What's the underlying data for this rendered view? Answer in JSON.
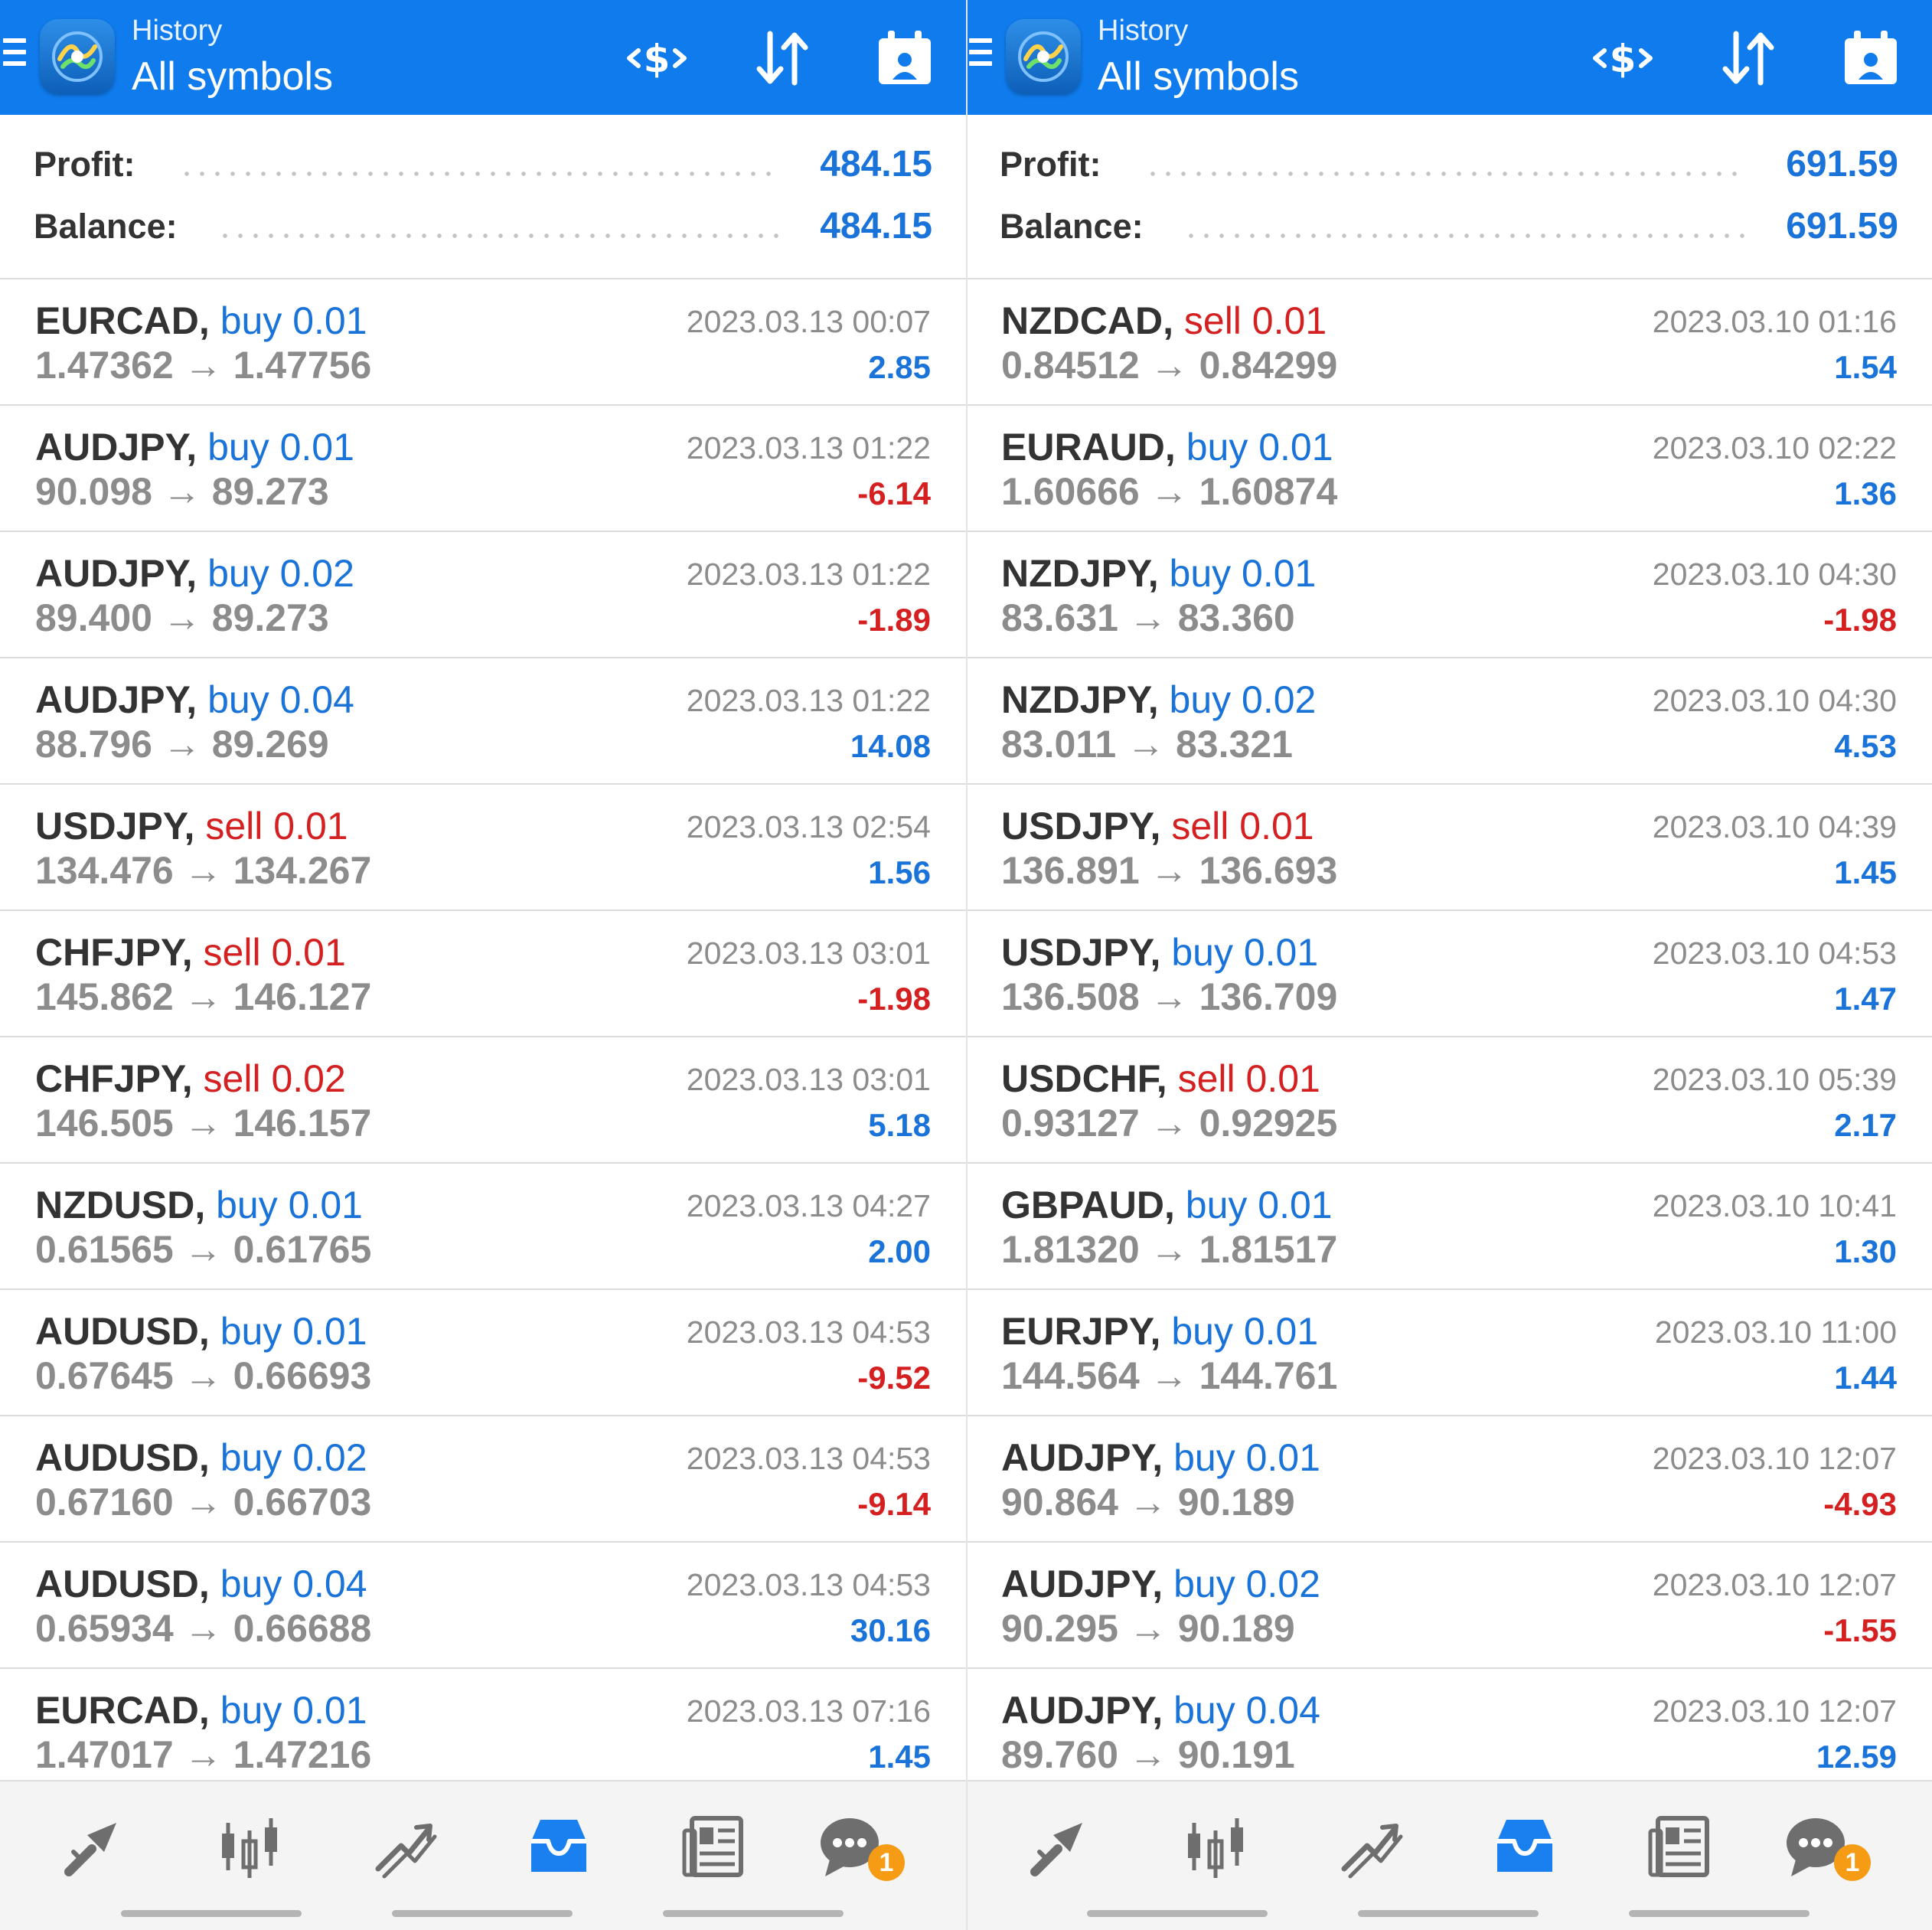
{
  "left": {
    "header": {
      "title": "History",
      "subtitle": "All symbols"
    },
    "summary": {
      "profit_label": "Profit:",
      "profit_value": "484.15",
      "balance_label": "Balance:",
      "balance_value": "484.15"
    },
    "deals": [
      {
        "symbol": "EURCAD,",
        "type": "buy 0.01",
        "side": "buy",
        "open": "1.47362",
        "close": "1.47756",
        "time": "2023.03.13 00:07",
        "profit": "2.85"
      },
      {
        "symbol": "AUDJPY,",
        "type": "buy 0.01",
        "side": "buy",
        "open": "90.098",
        "close": "89.273",
        "time": "2023.03.13 01:22",
        "profit": "-6.14"
      },
      {
        "symbol": "AUDJPY,",
        "type": "buy 0.02",
        "side": "buy",
        "open": "89.400",
        "close": "89.273",
        "time": "2023.03.13 01:22",
        "profit": "-1.89"
      },
      {
        "symbol": "AUDJPY,",
        "type": "buy 0.04",
        "side": "buy",
        "open": "88.796",
        "close": "89.269",
        "time": "2023.03.13 01:22",
        "profit": "14.08"
      },
      {
        "symbol": "USDJPY,",
        "type": "sell 0.01",
        "side": "sell",
        "open": "134.476",
        "close": "134.267",
        "time": "2023.03.13 02:54",
        "profit": "1.56"
      },
      {
        "symbol": "CHFJPY,",
        "type": "sell 0.01",
        "side": "sell",
        "open": "145.862",
        "close": "146.127",
        "time": "2023.03.13 03:01",
        "profit": "-1.98"
      },
      {
        "symbol": "CHFJPY,",
        "type": "sell 0.02",
        "side": "sell",
        "open": "146.505",
        "close": "146.157",
        "time": "2023.03.13 03:01",
        "profit": "5.18"
      },
      {
        "symbol": "NZDUSD,",
        "type": "buy 0.01",
        "side": "buy",
        "open": "0.61565",
        "close": "0.61765",
        "time": "2023.03.13 04:27",
        "profit": "2.00"
      },
      {
        "symbol": "AUDUSD,",
        "type": "buy 0.01",
        "side": "buy",
        "open": "0.67645",
        "close": "0.66693",
        "time": "2023.03.13 04:53",
        "profit": "-9.52"
      },
      {
        "symbol": "AUDUSD,",
        "type": "buy 0.02",
        "side": "buy",
        "open": "0.67160",
        "close": "0.66703",
        "time": "2023.03.13 04:53",
        "profit": "-9.14"
      },
      {
        "symbol": "AUDUSD,",
        "type": "buy 0.04",
        "side": "buy",
        "open": "0.65934",
        "close": "0.66688",
        "time": "2023.03.13 04:53",
        "profit": "30.16"
      },
      {
        "symbol": "EURCAD,",
        "type": "buy 0.01",
        "side": "buy",
        "open": "1.47017",
        "close": "1.47216",
        "time": "2023.03.13 07:16",
        "profit": "1.45"
      }
    ],
    "nav_badge": "1"
  },
  "right": {
    "header": {
      "title": "History",
      "subtitle": "All symbols"
    },
    "summary": {
      "profit_label": "Profit:",
      "profit_value": "691.59",
      "balance_label": "Balance:",
      "balance_value": "691.59"
    },
    "deals": [
      {
        "symbol": "NZDCAD,",
        "type": "sell 0.01",
        "side": "sell",
        "open": "0.84512",
        "close": "0.84299",
        "time": "2023.03.10 01:16",
        "profit": "1.54"
      },
      {
        "symbol": "EURAUD,",
        "type": "buy 0.01",
        "side": "buy",
        "open": "1.60666",
        "close": "1.60874",
        "time": "2023.03.10 02:22",
        "profit": "1.36"
      },
      {
        "symbol": "NZDJPY,",
        "type": "buy 0.01",
        "side": "buy",
        "open": "83.631",
        "close": "83.360",
        "time": "2023.03.10 04:30",
        "profit": "-1.98"
      },
      {
        "symbol": "NZDJPY,",
        "type": "buy 0.02",
        "side": "buy",
        "open": "83.011",
        "close": "83.321",
        "time": "2023.03.10 04:30",
        "profit": "4.53"
      },
      {
        "symbol": "USDJPY,",
        "type": "sell 0.01",
        "side": "sell",
        "open": "136.891",
        "close": "136.693",
        "time": "2023.03.10 04:39",
        "profit": "1.45"
      },
      {
        "symbol": "USDJPY,",
        "type": "buy 0.01",
        "side": "buy",
        "open": "136.508",
        "close": "136.709",
        "time": "2023.03.10 04:53",
        "profit": "1.47"
      },
      {
        "symbol": "USDCHF,",
        "type": "sell 0.01",
        "side": "sell",
        "open": "0.93127",
        "close": "0.92925",
        "time": "2023.03.10 05:39",
        "profit": "2.17"
      },
      {
        "symbol": "GBPAUD,",
        "type": "buy 0.01",
        "side": "buy",
        "open": "1.81320",
        "close": "1.81517",
        "time": "2023.03.10 10:41",
        "profit": "1.30"
      },
      {
        "symbol": "EURJPY,",
        "type": "buy 0.01",
        "side": "buy",
        "open": "144.564",
        "close": "144.761",
        "time": "2023.03.10 11:00",
        "profit": "1.44"
      },
      {
        "symbol": "AUDJPY,",
        "type": "buy 0.01",
        "side": "buy",
        "open": "90.864",
        "close": "90.189",
        "time": "2023.03.10 12:07",
        "profit": "-4.93"
      },
      {
        "symbol": "AUDJPY,",
        "type": "buy 0.02",
        "side": "buy",
        "open": "90.295",
        "close": "90.189",
        "time": "2023.03.10 12:07",
        "profit": "-1.55"
      },
      {
        "symbol": "AUDJPY,",
        "type": "buy 0.04",
        "side": "buy",
        "open": "89.760",
        "close": "90.191",
        "time": "2023.03.10 12:07",
        "profit": "12.59"
      }
    ],
    "nav_badge": "1"
  },
  "colors": {
    "header_bg": "#0f7bec",
    "buy": "#1a73d9",
    "sell": "#d42020",
    "badge": "#f59b14"
  },
  "icons": {
    "header": [
      "menu-icon",
      "metatrader-logo",
      "currency-exchange-icon",
      "sort-icon",
      "calendar-icon"
    ],
    "nav": [
      "quotes-icon",
      "chart-icon",
      "trade-icon",
      "history-icon",
      "news-icon",
      "chat-icon"
    ]
  }
}
